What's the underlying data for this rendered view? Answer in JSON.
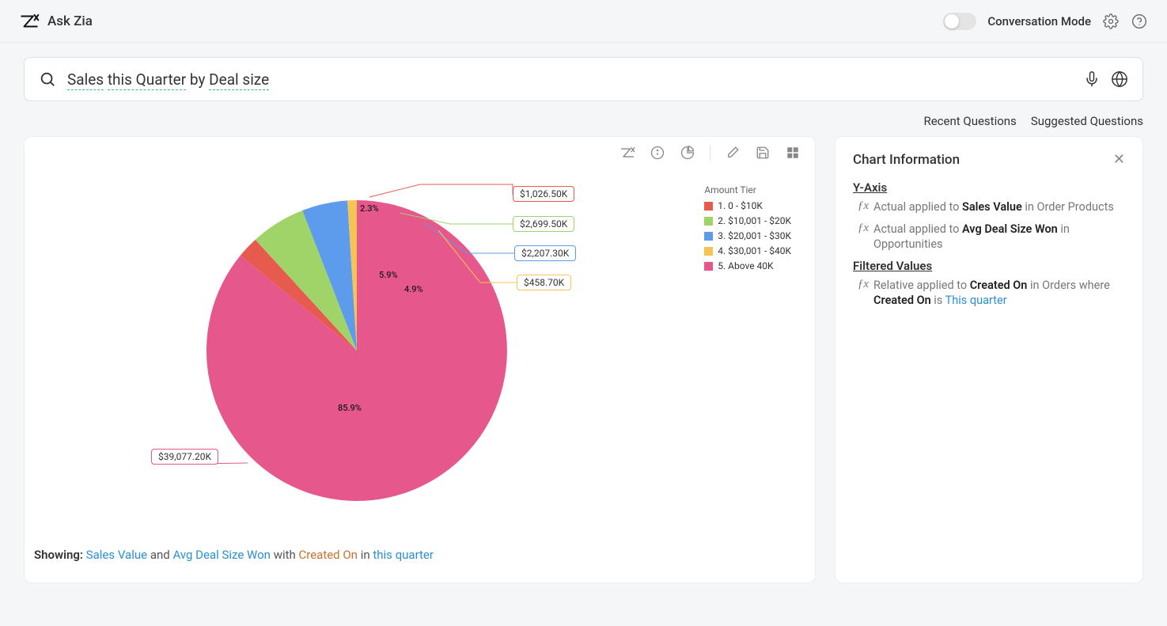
{
  "header": {
    "app_title": "Ask Zia",
    "mode_label": "Conversation Mode"
  },
  "search": {
    "p1": "Sales",
    "p2": "this Quarter",
    "mid": " by ",
    "p3": "Deal size"
  },
  "links": {
    "recent": "Recent Questions",
    "suggested": "Suggested Questions"
  },
  "chart_data": {
    "type": "pie",
    "title": "",
    "legend_title": "Amount Tier",
    "series": [
      {
        "name": "1. 0 - $10K",
        "percent": 2.3,
        "value_label": "$1,026.50K",
        "color": "#e75a4e"
      },
      {
        "name": "2. $10,001 - $20K",
        "percent": 5.9,
        "value_label": "$2,699.50K",
        "color": "#a0d468"
      },
      {
        "name": "3. $20,001 - $30K",
        "percent": 4.9,
        "value_label": "$2,207.30K",
        "color": "#5d9cec"
      },
      {
        "name": "4. $30,001 - $40K",
        "percent": 1.0,
        "value_label": "$458.70K",
        "color": "#f6c453"
      },
      {
        "name": "5. Above 40K",
        "percent": 85.9,
        "value_label": "$39,077.20K",
        "color": "#e6588b"
      }
    ]
  },
  "callouts": {
    "c1": "$1,026.50K",
    "c2": "$2,699.50K",
    "c3": "$2,207.30K",
    "c4": "$458.70K",
    "c5": "$39,077.20K",
    "p1": "2.3%",
    "p2": "5.9%",
    "p3": "4.9%",
    "p5": "85.9%"
  },
  "showing": {
    "label": "Showing:  ",
    "a": "Sales Value",
    "and": " and ",
    "b": "Avg Deal Size Won",
    "with": " with ",
    "c": "Created On",
    "in": " in ",
    "d": "this quarter"
  },
  "info": {
    "title": "Chart Information",
    "yaxis": "Y-Axis",
    "l1_a": "Actual",
    "l1_b": " applied to ",
    "l1_c": "Sales Value",
    "l1_d": " in Order Products",
    "l2_a": "Actual",
    "l2_b": " applied to ",
    "l2_c": "Avg Deal Size Won",
    "l2_d": " in Opportunities",
    "filtered": "Filtered Values",
    "f_a": "Relative",
    "f_b": " applied to ",
    "f_c": "Created On",
    "f_d": " in Orders where ",
    "f_e": "Created On",
    "f_f": " is ",
    "f_g": "This quarter"
  }
}
